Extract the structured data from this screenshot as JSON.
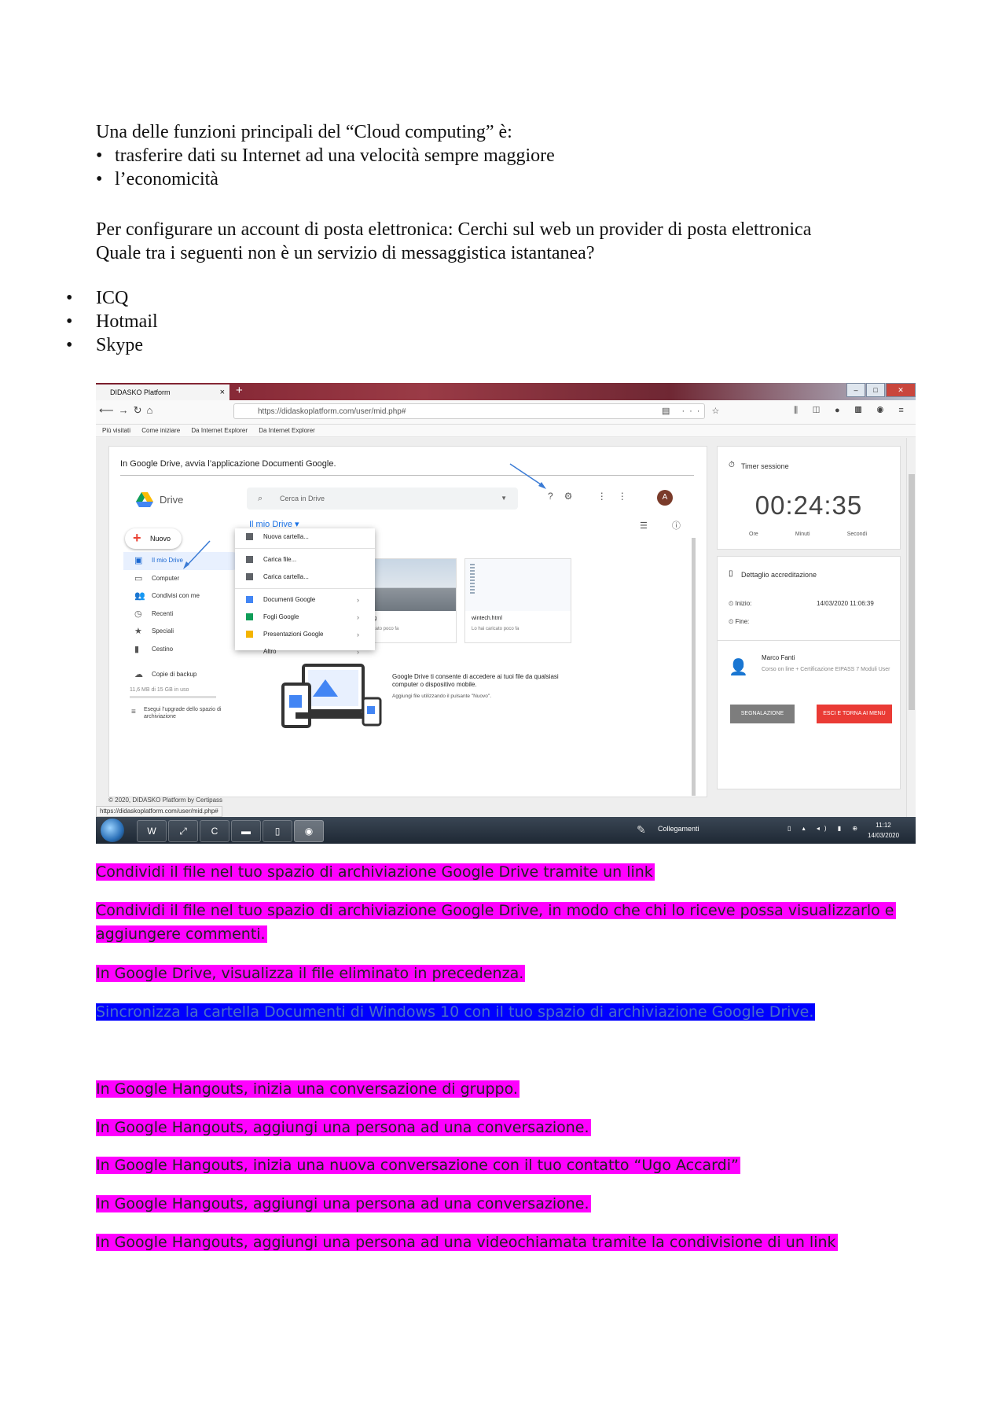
{
  "intro": {
    "question": "Una delle funzioni principali del “Cloud computing” è:",
    "options": [
      "trasferire dati su Internet ad una velocità sempre maggiore",
      "l’economicità"
    ]
  },
  "email": {
    "line1": "Per configurare un account di posta elettronica: Cerchi sul web un provider di posta elettronica",
    "line2": "Quale tra i seguenti non è un servizio di messaggistica istantanea?",
    "options": [
      "ICQ",
      "Hotmail",
      "Skype"
    ]
  },
  "screenshot": {
    "tab_title": "DIDASKO Platform",
    "url": "https://didaskoplatform.com/user/mid.php#",
    "bookmarks": [
      "Più visitati",
      "Come iniziare",
      "Da Internet Explorer",
      "Da Internet Explorer"
    ],
    "instruction": "In Google Drive, avvia l’applicazione Documenti Google.",
    "drive": {
      "name": "Drive",
      "search_placeholder": "Cerca in Drive",
      "my_drive": "Il mio Drive ▾",
      "new_button": "Nuovo",
      "sidebar": [
        "Il mio Drive",
        "Computer",
        "Condivisi con me",
        "Recenti",
        "Speciali",
        "Cestino",
        "Copie di backup"
      ],
      "storage": "11,6 MB di 15 GB in uso",
      "upgrade": "Esegui l’upgrade dello spazio di archiviazione",
      "menu": [
        "Nuova cartella...",
        "Carica file...",
        "Carica cartella...",
        "Documenti Google",
        "Fogli Google",
        "Presentazioni Google",
        "Altro"
      ],
      "avatar": "A",
      "files": [
        {
          "name": ".jpg",
          "sub": "aricato poco fa"
        },
        {
          "name": "wintech.html",
          "sub": "Lo hai caricato poco fa"
        }
      ],
      "promo_title": "Google Drive ti consente di accedere ai tuoi file da qualsiasi computer o dispositivo mobile.",
      "promo_sub": "Aggiungi file utilizzando il pulsante \"Nuovo\"."
    },
    "timer": {
      "label": "Timer sessione",
      "value": "00:24:35",
      "units": [
        "Ore",
        "Minuti",
        "Secondi"
      ]
    },
    "details": {
      "label": "Dettaglio accreditazione",
      "start_label": "Inizio:",
      "start_value": "14/03/2020 11:06:39",
      "end_label": "Fine:",
      "user_name": "Marco Fanti",
      "course": "Corso on line + Certificazione EIPASS 7 Moduli User",
      "btn_report": "SEGNALAZIONE",
      "btn_exit": "ESCI E TORNA AI MENU"
    },
    "footer": "© 2020, DIDASKO Platform by Certipass",
    "status_url": "https://didaskoplatform.com/user/mid.php#",
    "taskbar": {
      "links_label": "Collegamenti",
      "time": "11:12",
      "date": "14/03/2020"
    }
  },
  "tasks": [
    {
      "text": "Condividi il file nel tuo spazio di archiviazione Google Drive tramite un link",
      "highlight": "#ff00ff"
    },
    {
      "text": "Condividi il file nel tuo spazio di archiviazione Google Drive, in modo che chi lo riceve possa visualizzarlo e aggiungere commenti.",
      "highlight": "#ff00ff"
    },
    {
      "text": "In Google Drive, visualizza il file eliminato in precedenza.",
      "highlight": "#ff00ff"
    },
    {
      "text": "Sincronizza la cartella Documenti di Windows 10 con il tuo spazio di archiviazione Google Drive.",
      "highlight": "#0000ff"
    },
    {
      "text": "In Google Hangouts, inizia una conversazione di gruppo.",
      "highlight": "#ff00ff"
    },
    {
      "text": "In Google Hangouts, aggiungi una persona ad una conversazione.",
      "highlight": "#ff00ff"
    },
    {
      "text": "In Google Hangouts, inizia una nuova conversazione con il tuo contatto “Ugo Accardi”",
      "highlight": "#ff00ff"
    },
    {
      "text": "In Google Hangouts, aggiungi una persona ad una conversazione.",
      "highlight": "#ff00ff"
    },
    {
      "text": "In Google Hangouts, aggiungi una persona ad una videochiamata tramite la condivisione di un link",
      "highlight": "#ff00ff"
    }
  ]
}
